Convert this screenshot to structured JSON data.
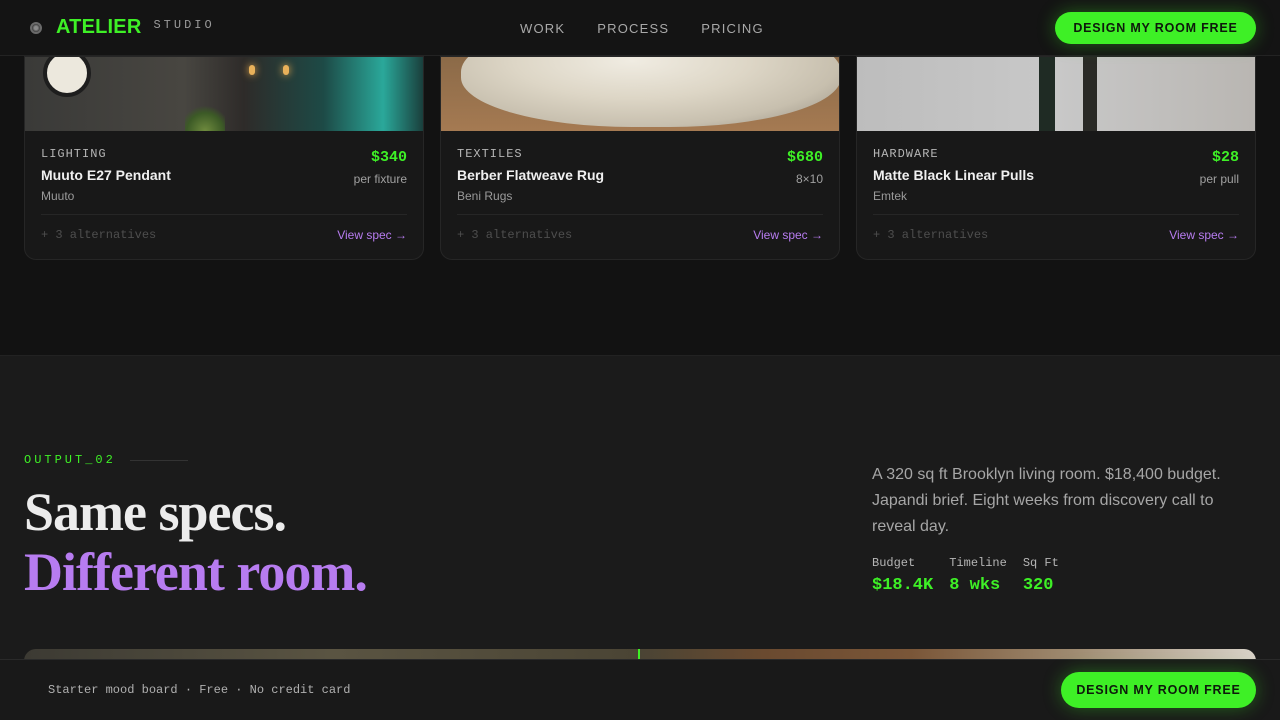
{
  "nav": {
    "logo_icon": "logo-mark-icon",
    "brand": "ATELIER",
    "brand_sub": "STUDIO",
    "links": [
      "WORK",
      "PROCESS",
      "PRICING"
    ],
    "cta": "DESIGN MY ROOM FREE"
  },
  "cards": [
    {
      "category": "LIGHTING",
      "name": "Muuto E27 Pendant",
      "brand": "Muuto",
      "price": "$340",
      "unit": "per fixture",
      "alternatives": "+ 3 alternatives",
      "link": "View spec →"
    },
    {
      "category": "TEXTILES",
      "name": "Berber Flatweave Rug",
      "brand": "Beni Rugs",
      "price": "$680",
      "unit": "8×10",
      "alternatives": "+ 3 alternatives",
      "link": "View spec →"
    },
    {
      "category": "HARDWARE",
      "name": "Matte Black Linear Pulls",
      "brand": "Emtek",
      "price": "$28",
      "unit": "per pull",
      "alternatives": "+ 3 alternatives",
      "link": "View spec →"
    }
  ],
  "section": {
    "tag": "OUTPUT_02",
    "heading_line1": "Same specs.",
    "heading_line2": "Different room.",
    "description": "A 320 sq ft Brooklyn living room. $18,400 budget. Japandi brief. Eight weeks from discovery call to reveal day.",
    "stats": [
      {
        "label": "Budget",
        "value": "$18.4K"
      },
      {
        "label": "Timeline",
        "value": "8 wks"
      },
      {
        "label": "Sq Ft",
        "value": "320"
      }
    ]
  },
  "bottom_bar": {
    "text": "Starter mood board · Free · No credit card",
    "cta": "DESIGN MY ROOM FREE"
  },
  "colors": {
    "accent_green": "#3ef026",
    "accent_purple": "#b77cf0",
    "background": "#121212"
  }
}
